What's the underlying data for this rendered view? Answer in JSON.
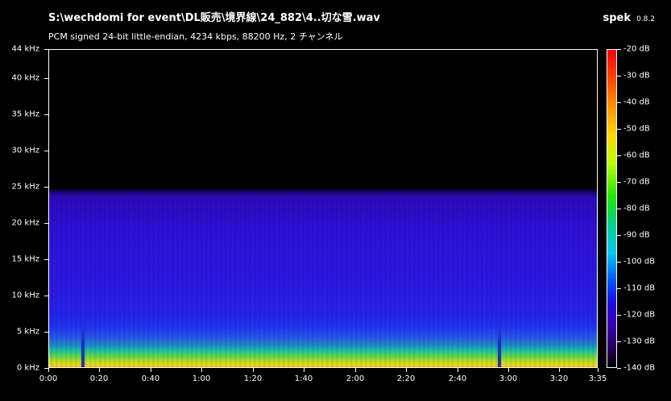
{
  "header": {
    "file_title": "S:\\wechdomi for event\\DL販売\\境界線\\24_882\\4..切な雪.wav",
    "file_info": "PCM signed 24-bit little-endian, 4234 kbps, 88200 Hz, 2 チャンネル",
    "app_name": "spek",
    "app_version": "0.8.2"
  },
  "frequency_axis": {
    "labels": [
      "0 kHz",
      "5 kHz",
      "10 kHz",
      "15 kHz",
      "20 kHz",
      "25 kHz",
      "30 kHz",
      "35 kHz",
      "40 kHz",
      "44 kHz"
    ],
    "values_khz": [
      0,
      5,
      10,
      15,
      20,
      25,
      30,
      35,
      40,
      44
    ]
  },
  "time_axis": {
    "labels": [
      "0:00",
      "0:20",
      "0:40",
      "1:00",
      "1:20",
      "1:40",
      "2:00",
      "2:20",
      "2:40",
      "3:00",
      "3:20",
      "3:35"
    ],
    "values_sec": [
      0,
      20,
      40,
      60,
      80,
      100,
      120,
      140,
      160,
      180,
      200,
      215
    ]
  },
  "db_scale": {
    "labels": [
      "-20 dB",
      "-30 dB",
      "-40 dB",
      "-50 dB",
      "-60 dB",
      "-70 dB",
      "-80 dB",
      "-90 dB",
      "-100 dB",
      "-110 dB",
      "-120 dB",
      "-130 dB",
      "-140 dB"
    ],
    "values_db": [
      -20,
      -30,
      -40,
      -50,
      -60,
      -70,
      -80,
      -90,
      -100,
      -110,
      -120,
      -130,
      -140
    ]
  },
  "spectrogram": {
    "cutoff_khz": 24,
    "quiet_gaps_sec": [
      13,
      176
    ]
  },
  "colors": {
    "background": "#000000",
    "text": "#ffffff"
  }
}
